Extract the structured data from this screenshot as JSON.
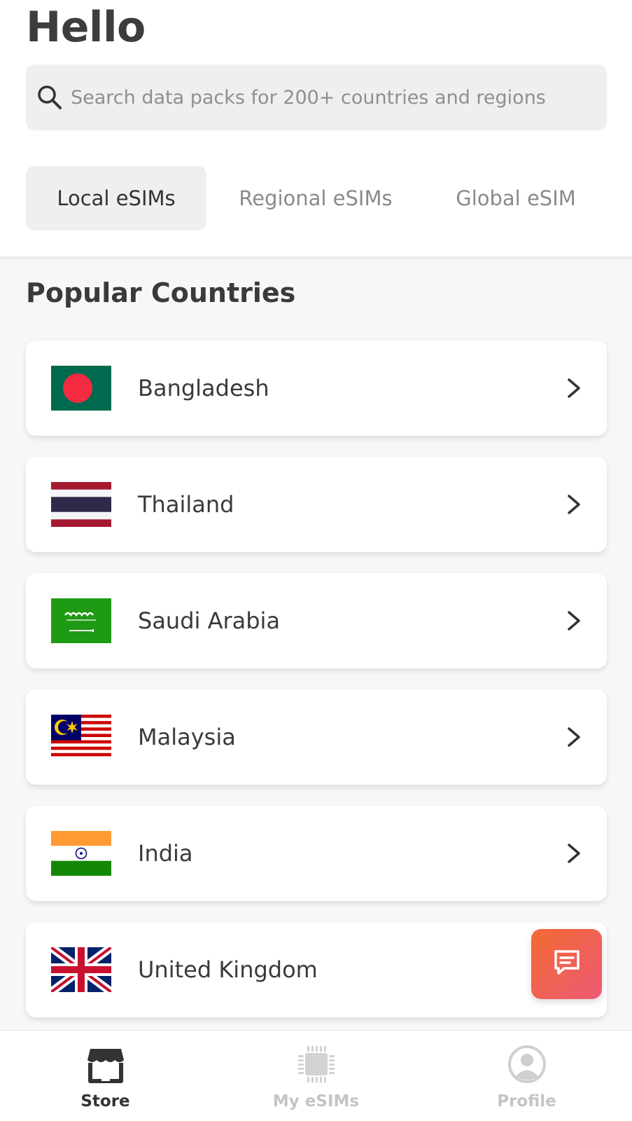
{
  "header": {
    "greeting": "Hello"
  },
  "search": {
    "placeholder": "Search data packs for 200+ countries and regions",
    "icon": "search-icon"
  },
  "tabs": [
    {
      "label": "Local eSIMs",
      "active": true
    },
    {
      "label": "Regional eSIMs",
      "active": false
    },
    {
      "label": "Global eSIM",
      "active": false
    }
  ],
  "section": {
    "title": "Popular Countries"
  },
  "countries": [
    {
      "name": "Bangladesh",
      "flag": "bangladesh-flag"
    },
    {
      "name": "Thailand",
      "flag": "thailand-flag"
    },
    {
      "name": "Saudi Arabia",
      "flag": "saudi-arabia-flag"
    },
    {
      "name": "Malaysia",
      "flag": "malaysia-flag"
    },
    {
      "name": "India",
      "flag": "india-flag"
    },
    {
      "name": "United Kingdom",
      "flag": "united-kingdom-flag"
    }
  ],
  "chat": {
    "icon": "chat-icon",
    "colors": [
      "#f26a32",
      "#ee5a75"
    ]
  },
  "bottom_nav": [
    {
      "label": "Store",
      "icon": "store-icon",
      "active": true
    },
    {
      "label": "My eSIMs",
      "icon": "sim-chip-icon",
      "active": false
    },
    {
      "label": "Profile",
      "icon": "profile-icon",
      "active": false
    }
  ]
}
